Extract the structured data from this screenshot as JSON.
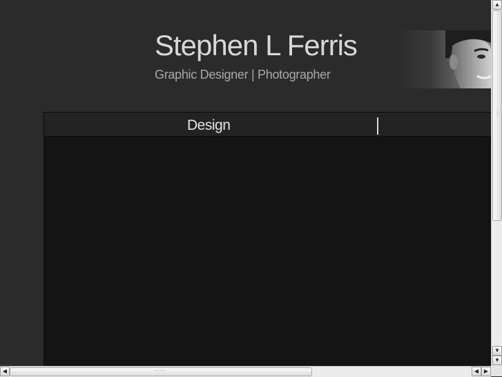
{
  "header": {
    "title": "Stephen L Ferris",
    "subtitle": "Graphic Designer | Photographer",
    "portrait_icon": "portrait-photo"
  },
  "nav": {
    "items": [
      {
        "label": "Design"
      }
    ]
  },
  "scrollbars": {
    "up_arrow": "▲",
    "down_arrow": "▼",
    "left_arrow": "◀",
    "right_arrow": "▶"
  },
  "colors": {
    "page_background": "#2b2b2b",
    "panel_background": "#141414",
    "title_text": "#d8d8d8",
    "subtitle_text": "#a9a9a9"
  }
}
